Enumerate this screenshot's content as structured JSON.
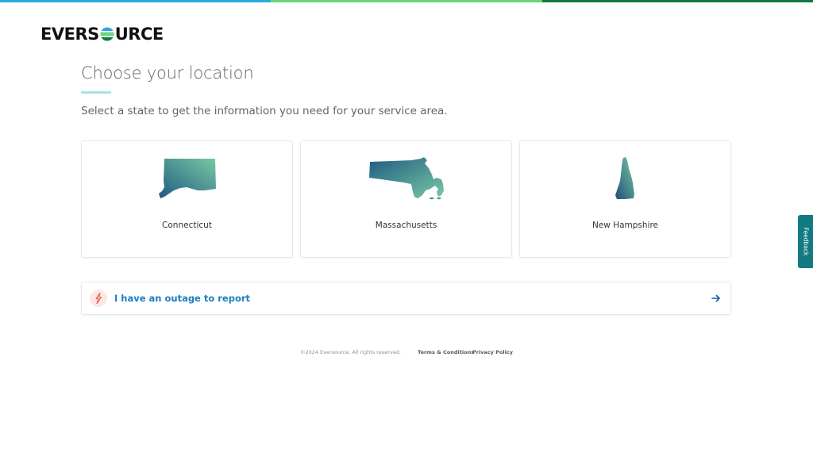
{
  "brand": {
    "logo_left": "EVERS",
    "logo_right": "URCE",
    "colors": {
      "blue": "#27a9e1",
      "light_green": "#6cd47e",
      "dark_green": "#0a7a45"
    }
  },
  "page": {
    "title": "Choose your location",
    "subtitle": "Select a state to get the information you need for your service area."
  },
  "states": [
    {
      "label": "Connecticut",
      "icon": "connecticut-map-icon"
    },
    {
      "label": "Massachusetts",
      "icon": "massachusetts-map-icon"
    },
    {
      "label": "New Hampshire",
      "icon": "new-hampshire-map-icon"
    }
  ],
  "outage": {
    "label": "I have an outage to report",
    "icon": "lightning-bolt-icon",
    "arrow_icon": "arrow-right-icon"
  },
  "footer": {
    "copyright": "©2024 Eversource. All rights reserved.",
    "terms": "Terms & Conditions",
    "privacy": "Privacy Policy"
  },
  "feedback": {
    "label": "Feedback"
  }
}
